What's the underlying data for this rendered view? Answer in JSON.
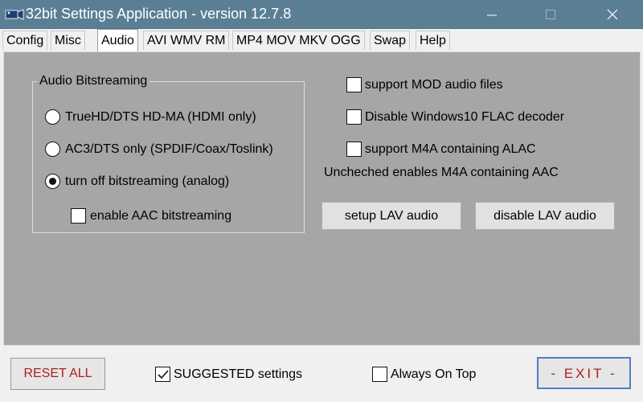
{
  "window": {
    "title": "32bit Settings Application - version 12.7.8"
  },
  "tabs": [
    {
      "label": "Config"
    },
    {
      "label": "Misc"
    },
    {
      "label": "Audio"
    },
    {
      "label": "AVI WMV RM"
    },
    {
      "label": "MP4 MOV MKV OGG"
    },
    {
      "label": "Swap"
    },
    {
      "label": "Help"
    }
  ],
  "active_tab": "Audio",
  "audio": {
    "group_title": "Audio Bitstreaming",
    "radio_options": [
      {
        "label": "TrueHD/DTS HD-MA (HDMI only)",
        "selected": false
      },
      {
        "label": "AC3/DTS only (SPDIF/Coax/Toslink)",
        "selected": false
      },
      {
        "label": "turn off bitstreaming (analog)",
        "selected": true
      }
    ],
    "aac_bitstreaming": {
      "label": "enable AAC bitstreaming",
      "checked": false
    },
    "checkboxes": [
      {
        "label": "support MOD audio files",
        "checked": false
      },
      {
        "label": "Disable Windows10 FLAC decoder",
        "checked": false
      },
      {
        "label": "support M4A containing ALAC",
        "checked": false
      }
    ],
    "note": "Uncheched enables M4A containing AAC",
    "setup_lav_label": "setup LAV audio",
    "disable_lav_label": "disable LAV audio"
  },
  "footer": {
    "reset_label": "RESET ALL",
    "suggested": {
      "label": "SUGGESTED settings",
      "checked": true
    },
    "always_on_top": {
      "label": "Always On Top",
      "checked": false
    },
    "exit_label": "- EXIT -"
  },
  "colors": {
    "titlebar": "#5a7f95",
    "panel": "#a6a6a6",
    "danger_text": "#b01e1e",
    "focus_border": "#4f7fc2"
  }
}
